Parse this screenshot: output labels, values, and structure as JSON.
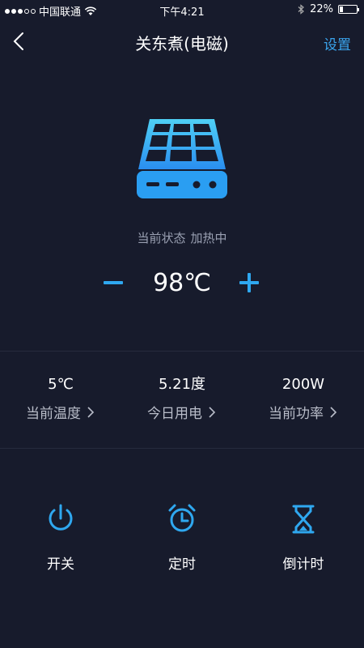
{
  "status_bar": {
    "carrier": "中国联通",
    "time": "下午4:21",
    "battery": "22%",
    "battery_level": 0.22,
    "signal_strength": 3,
    "signal_max": 5
  },
  "nav": {
    "back_icon": "chevron-left-icon",
    "title": "关东煮(电磁)",
    "settings_label": "设置"
  },
  "device": {
    "icon": "cooker-icon",
    "state_label": "当前状态",
    "state_value": "加热中"
  },
  "temperature": {
    "value": "98℃",
    "decrease_icon": "minus-icon",
    "increase_icon": "plus-icon"
  },
  "stats": [
    {
      "value": "5℃",
      "label": "当前温度"
    },
    {
      "value": "5.21度",
      "label": "今日用电"
    },
    {
      "value": "200W",
      "label": "当前功率"
    }
  ],
  "actions": [
    {
      "label": "开关",
      "icon": "power-icon"
    },
    {
      "label": "定时",
      "icon": "alarm-clock-icon"
    },
    {
      "label": "倒计时",
      "icon": "hourglass-icon"
    }
  ],
  "colors": {
    "background": "#171b2c",
    "accent": "#2fa8f0",
    "settings_link": "#3aa5ee",
    "muted_text": "#9aa0b2"
  }
}
